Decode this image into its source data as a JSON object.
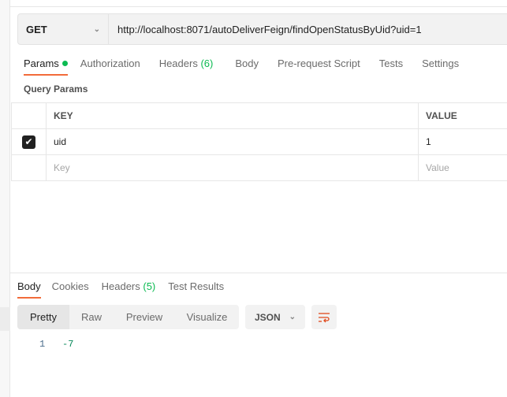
{
  "request": {
    "method": "GET",
    "url": "http://localhost:8071/autoDeliverFeign/findOpenStatusByUid?uid=1"
  },
  "request_tabs": [
    {
      "label": "Params"
    },
    {
      "label": "Authorization"
    },
    {
      "label": "Headers",
      "count": "(6)"
    },
    {
      "label": "Body"
    },
    {
      "label": "Pre-request Script"
    },
    {
      "label": "Tests"
    },
    {
      "label": "Settings"
    }
  ],
  "query_params": {
    "title": "Query Params",
    "headers": [
      "KEY",
      "VALUE"
    ],
    "rows": [
      {
        "checked": true,
        "key": "uid",
        "value": "1"
      }
    ],
    "key_placeholder": "Key",
    "value_placeholder": "Value"
  },
  "response_tabs": [
    {
      "label": "Body"
    },
    {
      "label": "Cookies"
    },
    {
      "label": "Headers",
      "count": "(5)"
    },
    {
      "label": "Test Results"
    }
  ],
  "view_modes": [
    "Pretty",
    "Raw",
    "Preview",
    "Visualize"
  ],
  "format": "JSON",
  "response_body": {
    "line": "1",
    "content": "-7"
  },
  "colors": {
    "accent": "#f26b3a",
    "green": "#0cbb52"
  }
}
